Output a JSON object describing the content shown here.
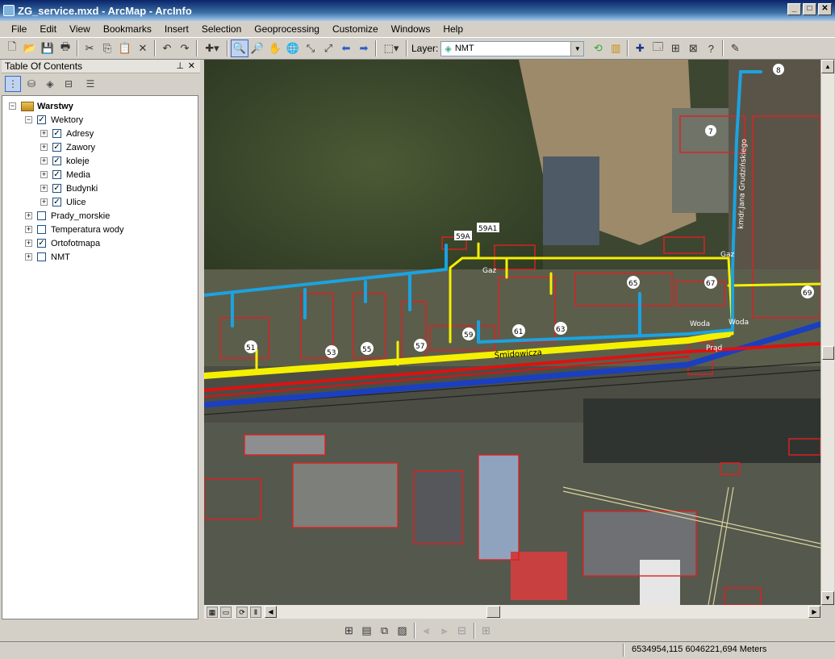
{
  "window": {
    "title": "ZG_service.mxd - ArcMap - ArcInfo",
    "controls": [
      "_",
      "□",
      "✕"
    ]
  },
  "menu": [
    "File",
    "Edit",
    "View",
    "Bookmarks",
    "Insert",
    "Selection",
    "Geoprocessing",
    "Customize",
    "Windows",
    "Help"
  ],
  "toolbar": {
    "layer_label": "Layer:",
    "layer_value": "NMT"
  },
  "toc": {
    "title": "Table Of Contents",
    "root": "Warstwy",
    "group": "Wektory",
    "sublayers": [
      {
        "label": "Adresy",
        "checked": true
      },
      {
        "label": "Zawory",
        "checked": true
      },
      {
        "label": "koleje",
        "checked": true
      },
      {
        "label": "Media",
        "checked": true
      },
      {
        "label": "Budynki",
        "checked": true
      },
      {
        "label": "Ulice",
        "checked": true
      }
    ],
    "layers": [
      {
        "label": "Prady_morskie",
        "checked": false
      },
      {
        "label": "Temperatura wody",
        "checked": false
      },
      {
        "label": "Ortofotmapa",
        "checked": true
      },
      {
        "label": "NMT",
        "checked": false
      }
    ]
  },
  "map": {
    "address_labels": [
      "8",
      "7",
      "59A",
      "59A1",
      "65",
      "67",
      "69",
      "51",
      "53",
      "55",
      "57",
      "59",
      "61",
      "63"
    ],
    "street_names": [
      "Śmidowicza",
      "kmdr.Jana Grudzińskiego"
    ],
    "utility_labels": [
      "Gaz",
      "Gaz",
      "Woda",
      "Woda",
      "Prąd"
    ],
    "colors": {
      "gas": "#f5f000",
      "water": "#1ba3e0",
      "water_main": "#1a3fc0",
      "power": "#e01010",
      "building": "#e02020"
    }
  },
  "status": {
    "coordinates": "6534954,115  6046221,694 Meters"
  }
}
